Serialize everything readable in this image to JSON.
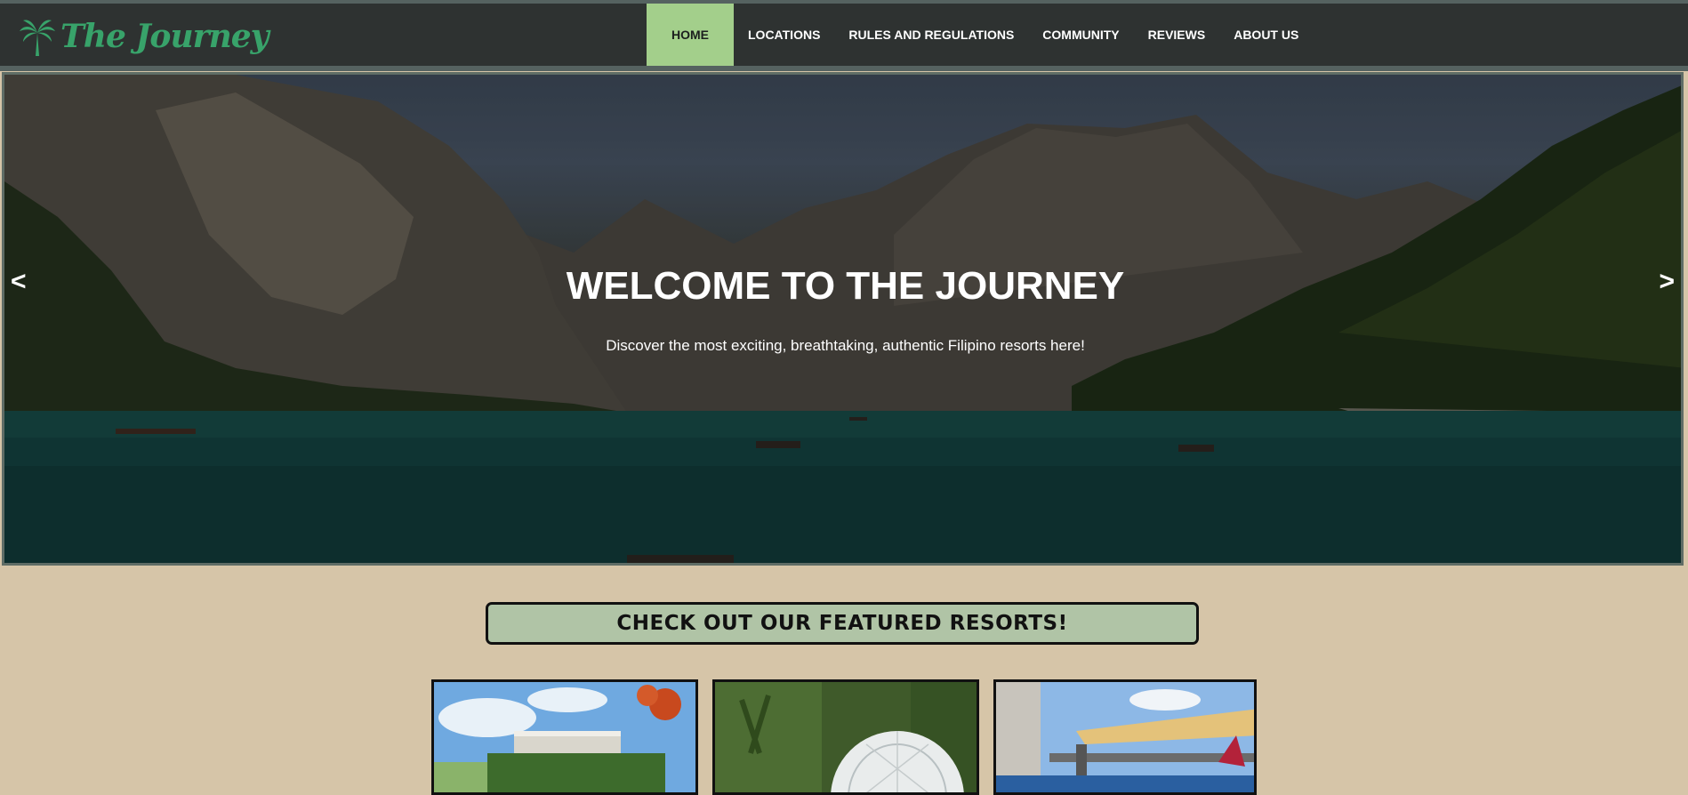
{
  "header": {
    "logo_text": "The Journey",
    "logo_icon": "palm-tree-icon",
    "nav": [
      {
        "label": "HOME",
        "active": true
      },
      {
        "label": "LOCATIONS"
      },
      {
        "label": "RULES AND REGULATIONS"
      },
      {
        "label": "COMMUNITY"
      },
      {
        "label": "REVIEWS"
      },
      {
        "label": "ABOUT US"
      }
    ]
  },
  "hero": {
    "title": "WELCOME TO THE JOURNEY",
    "subtitle": "Discover the most exciting, breathtaking, authentic Filipino resorts here!",
    "prev_label": "<",
    "next_label": ">"
  },
  "featured": {
    "heading": "CHECK OUT OUR FEATURED RESORTS!",
    "cards": [
      {
        "image": "modern-building-hedge-photo"
      },
      {
        "image": "glamping-dome-photo"
      },
      {
        "image": "rooftop-pool-photo"
      }
    ]
  },
  "colors": {
    "nav_bg": "#2e3231",
    "nav_active": "#a3cf8b",
    "logo": "#38a36a",
    "page_bg": "#d6c5a8",
    "featured_bg": "#b0c4a6"
  }
}
